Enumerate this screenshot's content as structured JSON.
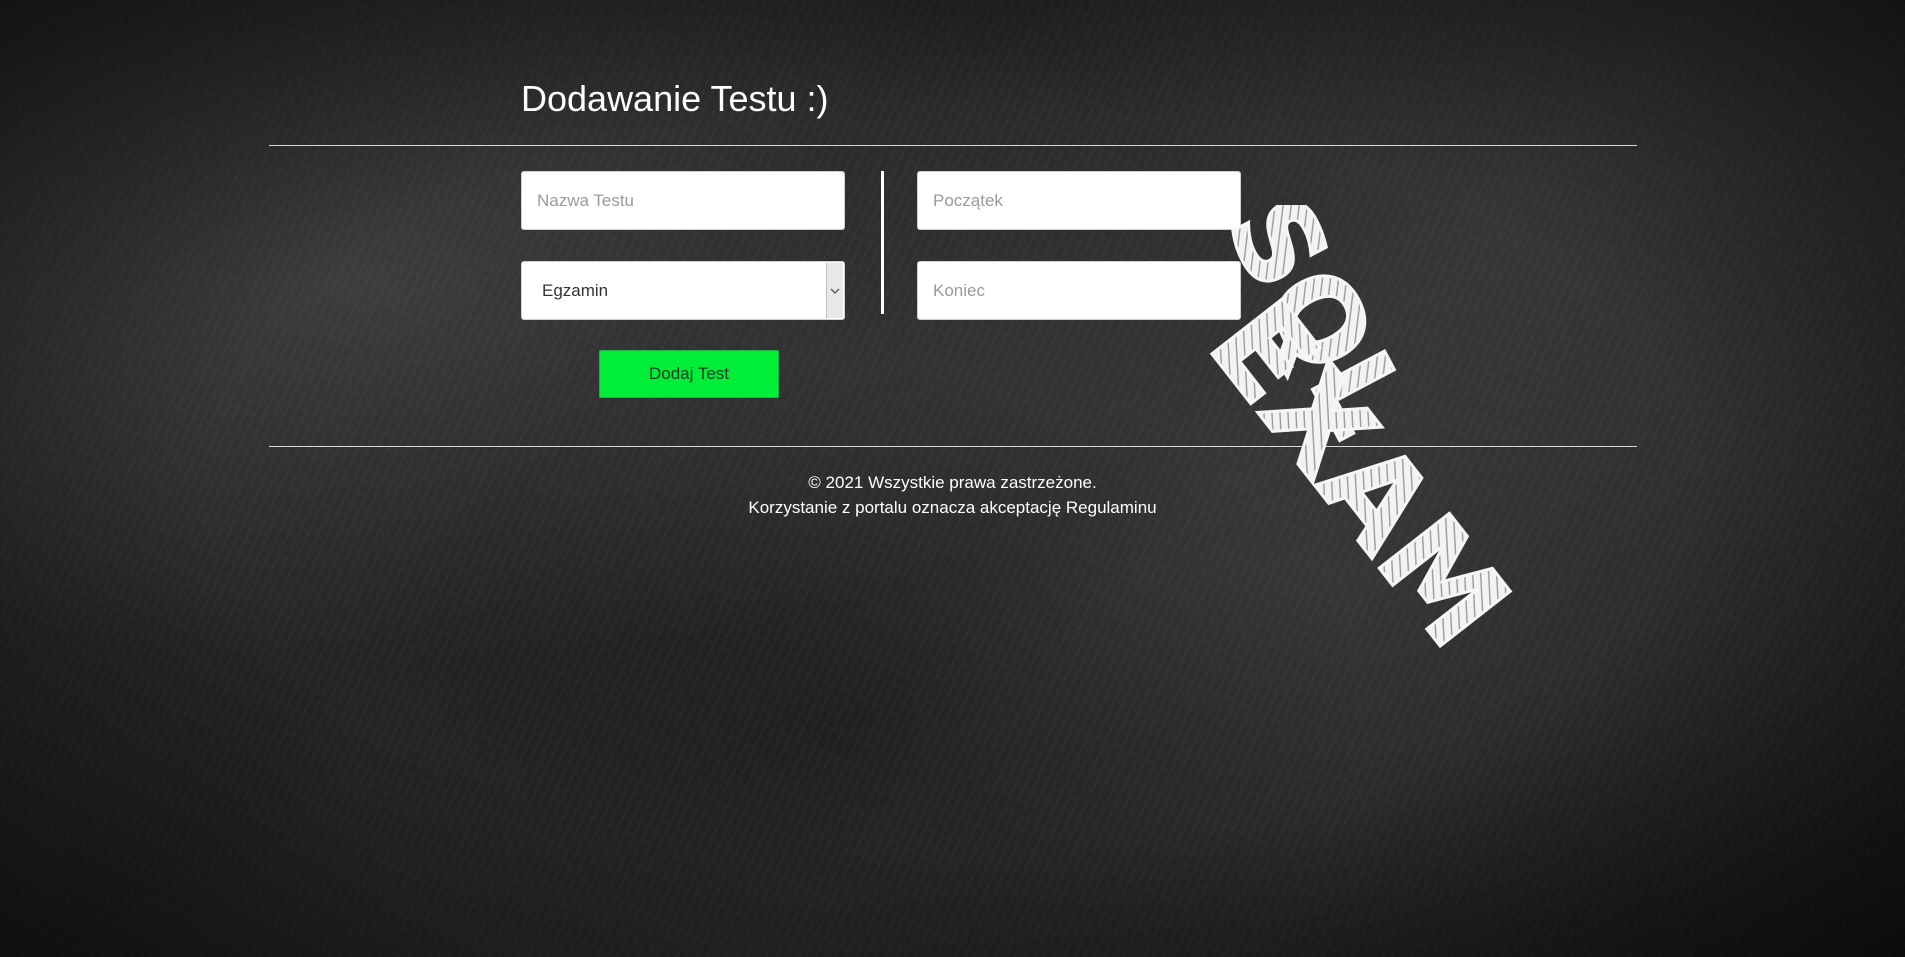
{
  "page": {
    "title": "Dodawanie Testu :)"
  },
  "form": {
    "name_placeholder": "Nazwa Testu",
    "type_selected": "Egzamin",
    "start_placeholder": "Początek",
    "end_placeholder": "Koniec",
    "submit_label": "Dodaj Test"
  },
  "footer": {
    "copyright": "© 2021 Wszystkie prawa zastrzeżone.",
    "terms": "Korzystanie z portalu oznacza akceptację Regulaminu"
  },
  "logo": {
    "line1": "SQL",
    "line2": "EXAM"
  },
  "colors": {
    "submit_bg": "#00ee38",
    "text": "#ffffff"
  }
}
